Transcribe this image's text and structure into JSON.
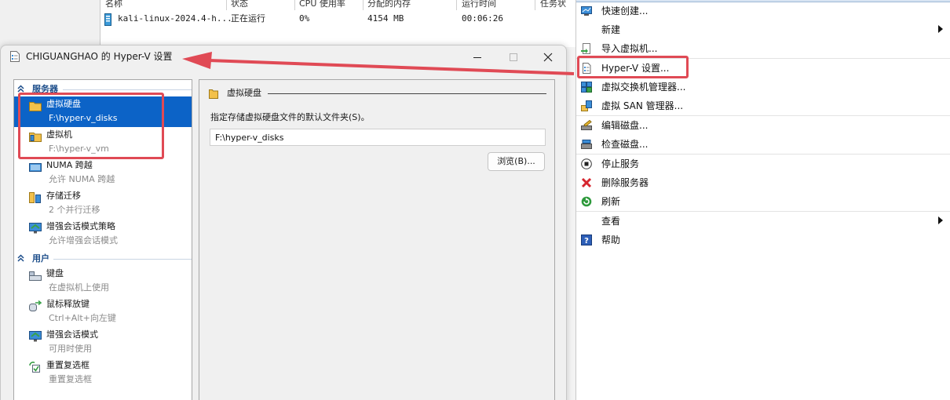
{
  "vm_list": {
    "headers": [
      "名称",
      "状态",
      "CPU 使用率",
      "分配的内存",
      "运行时间",
      "任务状"
    ],
    "row": {
      "name": "kali-linux-2024.4-h...",
      "state": "正在运行",
      "cpu": "0%",
      "memory": "4154 MB",
      "uptime": "00:06:26"
    }
  },
  "actions": {
    "items": [
      {
        "label": "快速创建...",
        "icon": "quick-create-icon"
      },
      {
        "label": "新建",
        "icon": "none",
        "submenu": true
      },
      {
        "label": "导入虚拟机...",
        "icon": "import-vm-icon"
      },
      {
        "label": "Hyper-V 设置...",
        "icon": "settings-page-icon"
      },
      {
        "label": "虚拟交换机管理器...",
        "icon": "switch-manager-icon"
      },
      {
        "label": "虚拟 SAN 管理器...",
        "icon": "san-manager-icon"
      },
      {
        "label": "编辑磁盘...",
        "icon": "edit-disk-icon"
      },
      {
        "label": "检查磁盘...",
        "icon": "inspect-disk-icon"
      },
      {
        "label": "停止服务",
        "icon": "stop-icon"
      },
      {
        "label": "删除服务器",
        "icon": "delete-icon"
      },
      {
        "label": "刷新",
        "icon": "refresh-icon"
      },
      {
        "label": "查看",
        "icon": "none",
        "submenu": true
      },
      {
        "label": "帮助",
        "icon": "help-icon"
      }
    ]
  },
  "dialog": {
    "title": "CHIGUANGHAO 的 Hyper-V 设置",
    "tree": {
      "server_header": "服务器",
      "user_header": "用户",
      "server_items": [
        {
          "label": "虚拟硬盘",
          "sub": "F:\\hyper-v_disks",
          "icon": "folder-icon",
          "selected": true
        },
        {
          "label": "虚拟机",
          "sub": "F:\\hyper-v_vm",
          "icon": "vm-folder-icon"
        },
        {
          "label": "NUMA 跨越",
          "sub": "允许 NUMA 跨越",
          "icon": "numa-icon"
        },
        {
          "label": "存储迁移",
          "sub": "2 个并行迁移",
          "icon": "storage-migration-icon"
        },
        {
          "label": "增强会话模式策略",
          "sub": "允许增强会话模式",
          "icon": "enhanced-session-icon"
        }
      ],
      "user_items": [
        {
          "label": "键盘",
          "sub": "在虚拟机上使用",
          "icon": "keyboard-icon"
        },
        {
          "label": "鼠标释放键",
          "sub": "Ctrl+Alt+向左键",
          "icon": "mouse-release-icon"
        },
        {
          "label": "增强会话模式",
          "sub": "可用时使用",
          "icon": "enhanced-session-icon"
        },
        {
          "label": "重置复选框",
          "sub": "重置复选框",
          "icon": "reset-checkbox-icon"
        }
      ]
    },
    "content": {
      "title": "虚拟硬盘",
      "folder_label": "指定存储虚拟硬盘文件的默认文件夹(S)。",
      "folder_value": "F:\\hyper-v_disks",
      "browse_label": "浏览(B)..."
    }
  },
  "colors": {
    "selection": "#0c63c7",
    "annotation_red": "#e04a55",
    "section_header": "#1c4d8a"
  }
}
